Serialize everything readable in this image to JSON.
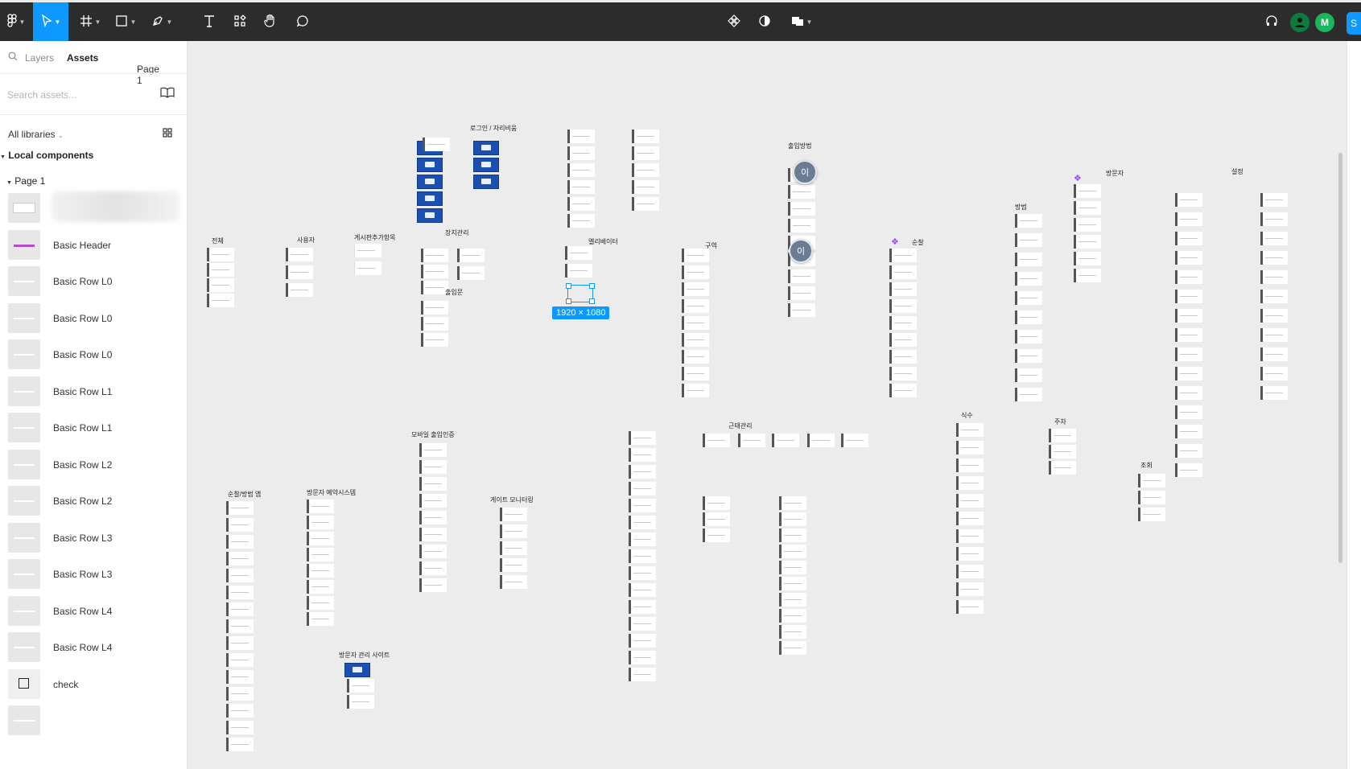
{
  "toolbar": {
    "selection_zoom": "1920 × 1080",
    "avatar_user": "M",
    "share_initial": "S",
    "colors": {
      "bg": "#2c2c2c",
      "active": "#0d99ff",
      "avatar_green": "#1bb55c",
      "avatar_dark": "#0e7a3e"
    }
  },
  "sidebar": {
    "tab_layers": "Layers",
    "tab_assets": "Assets",
    "page_select": "Page 1",
    "search_placeholder": "Search assets...",
    "libraries": "All libraries",
    "section_local": "Local components",
    "subsection_page": "Page 1",
    "components": [
      {
        "label": "",
        "thumb": "blurred"
      },
      {
        "label": "Basic Header",
        "thumb": "header"
      },
      {
        "label": "Basic Row L0",
        "thumb": "line"
      },
      {
        "label": "Basic Row L0",
        "thumb": "line"
      },
      {
        "label": "Basic Row L0",
        "thumb": "line"
      },
      {
        "label": "Basic Row L1",
        "thumb": "line"
      },
      {
        "label": "Basic Row L1",
        "thumb": "line"
      },
      {
        "label": "Basic Row L2",
        "thumb": "line"
      },
      {
        "label": "Basic Row L2",
        "thumb": "line"
      },
      {
        "label": "Basic Row L3",
        "thumb": "line"
      },
      {
        "label": "Basic Row L3",
        "thumb": "line"
      },
      {
        "label": "Basic Row L4",
        "thumb": "line"
      },
      {
        "label": "Basic Row L4",
        "thumb": "line"
      },
      {
        "label": "check",
        "thumb": "checkbox"
      },
      {
        "label": "",
        "thumb": "line"
      }
    ]
  },
  "canvas": {
    "labels": {
      "login": "로그인 / 자리비움",
      "entry_method": "출입방법",
      "visitor": "방문자",
      "settings": "설정",
      "room": "방범",
      "all": "전체",
      "user": "사용자",
      "board_add": "게시판추가항목",
      "device_mgmt": "장치관리",
      "elevator": "엘리베이터",
      "zone": "구역",
      "patrol": "순찰",
      "entry_gate": "출입문",
      "mobile_auth": "모바일 출입인증",
      "attendance": "근태관리",
      "meal": "식수",
      "parking": "주차",
      "lookup": "조회",
      "patrol_app": "순찰/방범 앱",
      "visitor_reservation": "방문자 예약시스템",
      "gate_monitoring": "게이트 모니터링",
      "visitor_admin": "방문자 관리 사이트"
    },
    "bubble_text": "이"
  }
}
